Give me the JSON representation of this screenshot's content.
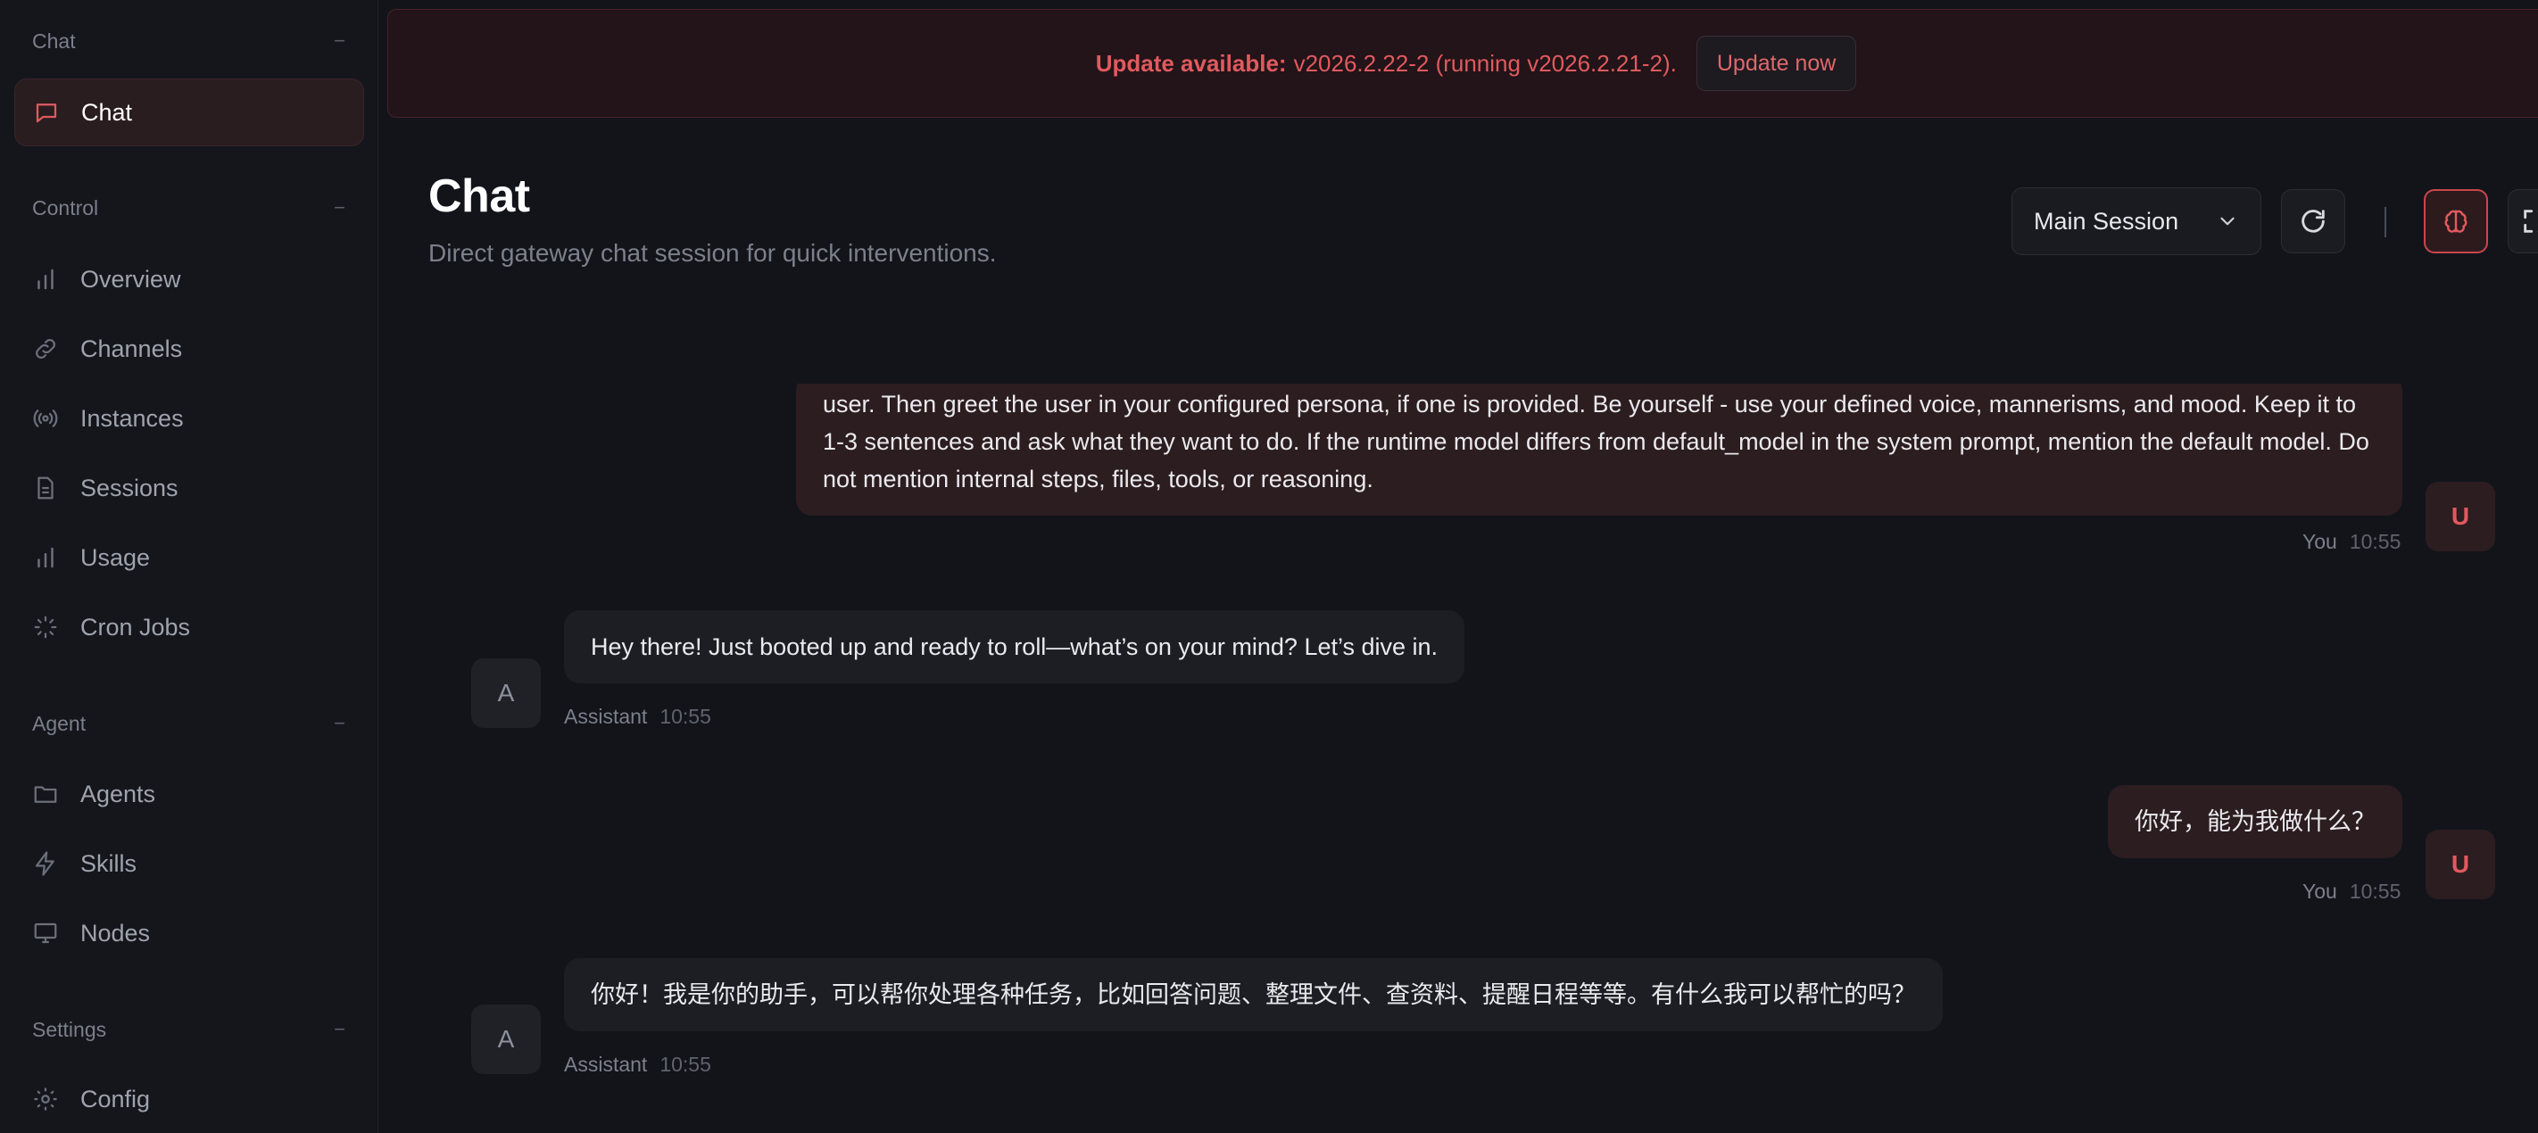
{
  "sidebar": {
    "groups": [
      {
        "label": "Chat",
        "collapse": "−"
      },
      {
        "label": "Control",
        "collapse": "−"
      },
      {
        "label": "Agent",
        "collapse": "−"
      },
      {
        "label": "Settings",
        "collapse": "−"
      }
    ],
    "items": {
      "chat": "Chat",
      "overview": "Overview",
      "channels": "Channels",
      "instances": "Instances",
      "sessions": "Sessions",
      "usage": "Usage",
      "cron_jobs": "Cron Jobs",
      "agents": "Agents",
      "skills": "Skills",
      "nodes": "Nodes",
      "config": "Config"
    }
  },
  "banner": {
    "label": "Update available:",
    "message": "v2026.2.22-2 (running v2026.2.21-2).",
    "button": "Update now"
  },
  "header": {
    "title": "Chat",
    "subtitle": "Direct gateway chat session for quick interventions.",
    "session_selected": "Main Session"
  },
  "messages": [
    {
      "role": "user",
      "text": "user. Then greet the user in your configured persona, if one is provided. Be yourself - use your defined voice, mannerisms, and mood. Keep it to 1-3 sentences and ask what they want to do. If the runtime model differs from default_model in the system prompt, mention the default model. Do not mention internal steps, files, tools, or reasoning.",
      "sender": "You",
      "time": "10:55",
      "avatar": "U"
    },
    {
      "role": "assistant",
      "text": "Hey there! Just booted up and ready to roll—what’s on your mind? Let’s dive in.",
      "sender": "Assistant",
      "time": "10:55",
      "avatar": "A"
    },
    {
      "role": "user",
      "text": "你好，能为我做什么？",
      "sender": "You",
      "time": "10:55",
      "avatar": "U"
    },
    {
      "role": "assistant",
      "text": "你好！我是你的助手，可以帮你处理各种任务，比如回答问题、整理文件、查资料、提醒日程等等。有什么我可以帮忙的吗？",
      "sender": "Assistant",
      "time": "10:55",
      "avatar": "A"
    }
  ],
  "colors": {
    "accent": "#e05a5f",
    "background": "#12141a",
    "sidebar": "#14161c",
    "user_bubble": "#2c1d20",
    "assistant_bubble": "#1c1e24"
  }
}
